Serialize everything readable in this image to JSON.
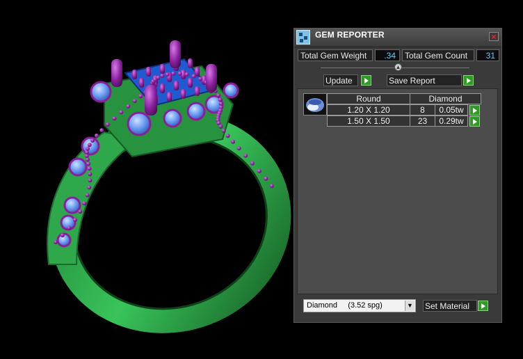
{
  "panel": {
    "title": "GEM REPORTER",
    "close_label": "×",
    "total_weight_label": "Total Gem Weight",
    "total_weight_value": ".34",
    "total_count_label": "Total Gem Count",
    "total_count_value": "31",
    "update_label": "Update",
    "save_report_label": "Save Report"
  },
  "gem_table": {
    "header": [
      "Round",
      "Diamond"
    ],
    "rows": [
      {
        "size": "1.20 X 1.20",
        "count": "8",
        "weight": "0.05tw"
      },
      {
        "size": "1.50 X 1.50",
        "count": "23",
        "weight": "0.29tw"
      }
    ]
  },
  "material": {
    "selected": "Diamond     (3.52 spg)",
    "set_material_label": "Set Material"
  },
  "colors": {
    "ring_metal": "#2ea84a",
    "prongs": "#8a1f9c",
    "gems": "#5a8ff0",
    "accent_button": "#2f9a25",
    "value_text": "#5fd0ff"
  }
}
